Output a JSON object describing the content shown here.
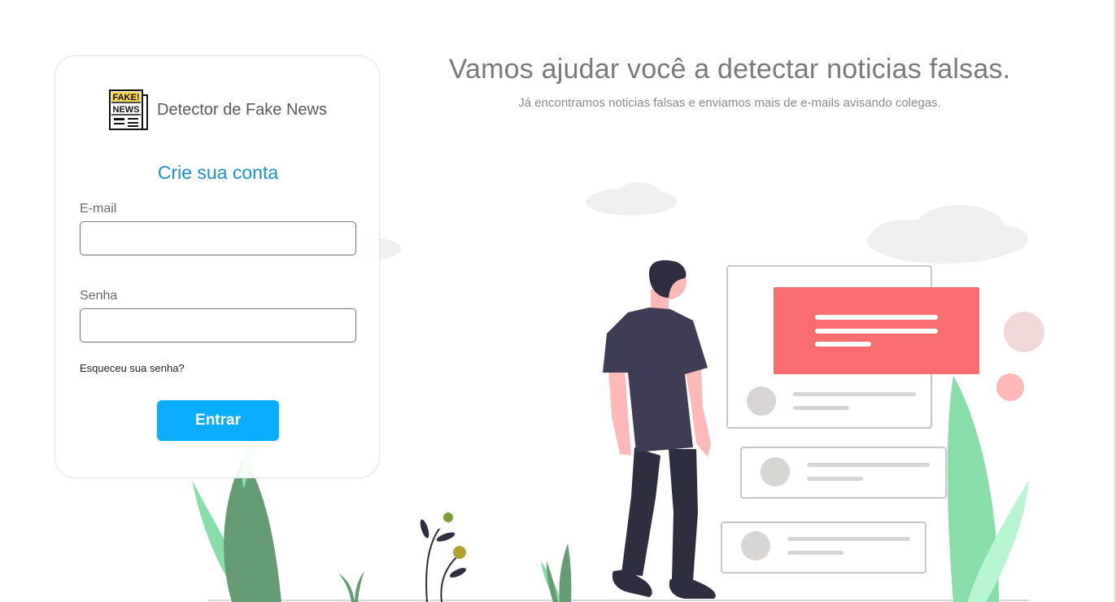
{
  "hero": {
    "title": "Vamos ajudar você a detectar noticias falsas.",
    "subtitle": "Já encontramos noticias falsas e enviamos mais de e-mails avisando colegas."
  },
  "brand": {
    "name": "Detector de Fake News",
    "logo_text_top": "FAKE!",
    "logo_text_bottom": "NEWS",
    "logo_icon": "fake-news-newspaper-icon"
  },
  "form": {
    "title": "Crie sua conta",
    "email_label": "E-mail",
    "email_value": "",
    "password_label": "Senha",
    "password_value": "",
    "forgot_password": "Esqueceu sua senha?",
    "submit_label": "Entrar"
  },
  "colors": {
    "accent_title": "#1a93c6",
    "button": "#0aaefc",
    "illustration_red": "#f86d6d",
    "plant_green": "#88dda9",
    "person_shirt": "#3f3d56"
  }
}
